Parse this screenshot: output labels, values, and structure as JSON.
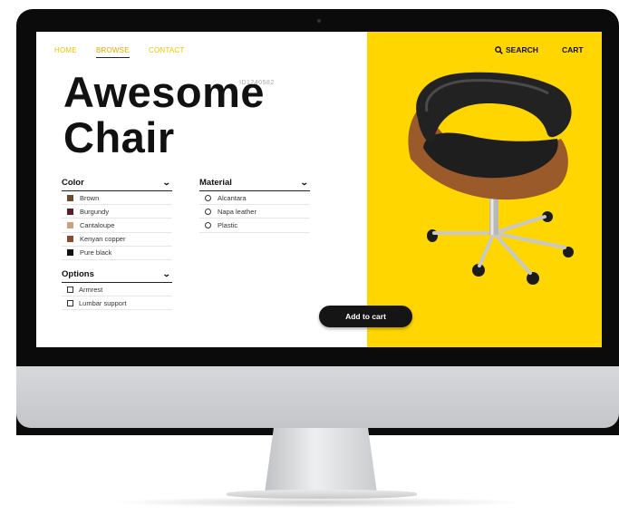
{
  "nav": {
    "home": "HOME",
    "browse": "BROWSE",
    "contact": "CONTACT",
    "search": "SEARCH",
    "cart": "CART"
  },
  "product": {
    "title_line1": "Awesome",
    "title_line2": "Chair",
    "id": "ID1240582"
  },
  "color_group": {
    "heading": "Color",
    "items": [
      {
        "label": "Brown",
        "swatch": "#6b4a2e"
      },
      {
        "label": "Burgundy",
        "swatch": "#5a1f2a"
      },
      {
        "label": "Cantaloupe",
        "swatch": "#c9a27a"
      },
      {
        "label": "Kenyan copper",
        "swatch": "#8a4a2f"
      },
      {
        "label": "Pure black",
        "swatch": "#111111"
      }
    ]
  },
  "material_group": {
    "heading": "Material",
    "items": [
      "Alcantara",
      "Napa leather",
      "Plastic"
    ]
  },
  "options_group": {
    "heading": "Options",
    "items": [
      "Armrest",
      "Lumbar support"
    ]
  },
  "add_to_cart": "Add to cart",
  "colors": {
    "accent_yellow": "#ffd600",
    "nav_yellow": "#f2c200",
    "dark": "#151515"
  },
  "icons": {
    "search": "search-icon",
    "chevron": "chevron-down-icon"
  }
}
